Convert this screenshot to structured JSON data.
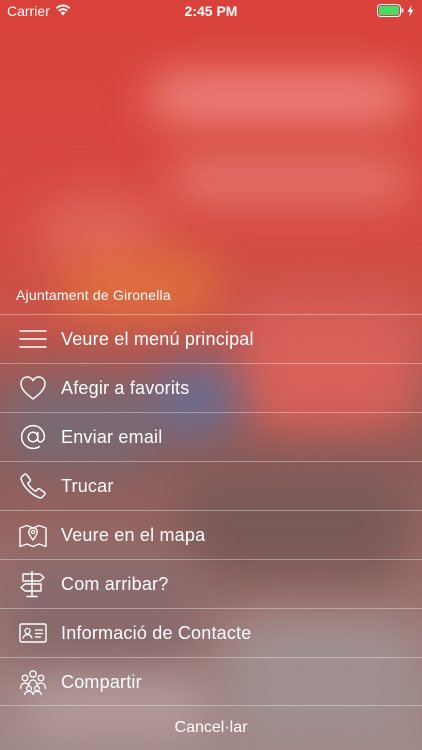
{
  "status_bar": {
    "carrier": "Carrier",
    "time": "2:45 PM",
    "wifi_icon": "wifi-icon",
    "battery_icon": "battery-full-icon",
    "charging_icon": "charging-bolt-icon"
  },
  "sheet": {
    "title": "Ajuntament de Gironella",
    "items": [
      {
        "label": "Veure el menú principal",
        "icon": "hamburger-menu-icon"
      },
      {
        "label": "Afegir a favorits",
        "icon": "heart-icon"
      },
      {
        "label": "Enviar email",
        "icon": "at-sign-icon"
      },
      {
        "label": "Trucar",
        "icon": "phone-icon"
      },
      {
        "label": "Veure en el mapa",
        "icon": "map-pin-icon"
      },
      {
        "label": "Com arribar?",
        "icon": "signpost-icon"
      },
      {
        "label": "Informació de Contacte",
        "icon": "contact-card-icon"
      },
      {
        "label": "Compartir",
        "icon": "people-group-icon"
      }
    ],
    "cancel_label": "Cancel·lar"
  },
  "colors": {
    "backdrop_top": "#d9423a",
    "backdrop_bottom": "#a08888",
    "text": "#ffffff",
    "battery": "#4cd964"
  }
}
